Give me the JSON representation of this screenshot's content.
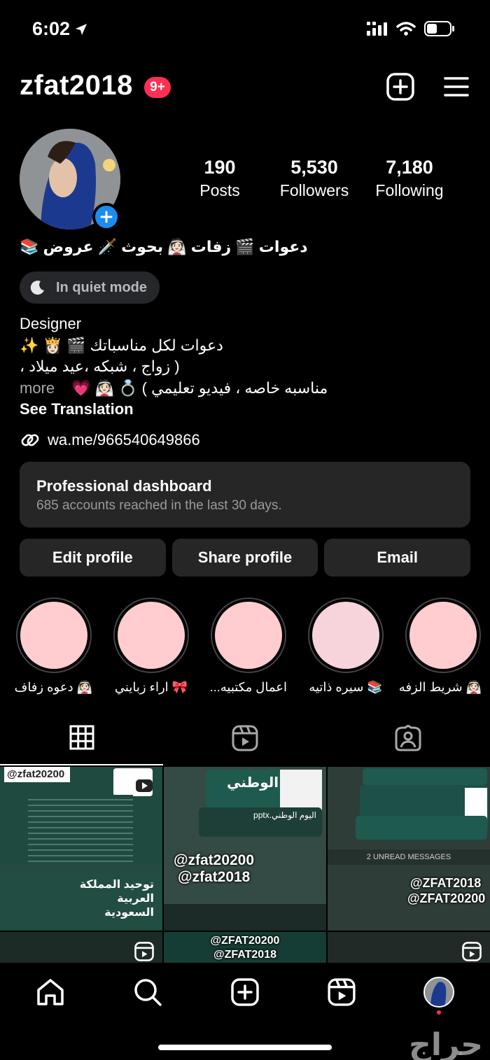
{
  "status_bar": {
    "time": "6:02"
  },
  "header": {
    "username": "zfat2018",
    "notif_badge": "9+"
  },
  "profile": {
    "stats": [
      {
        "value": "190",
        "label": "Posts"
      },
      {
        "value": "5,530",
        "label": "Followers"
      },
      {
        "value": "7,180",
        "label": "Following"
      }
    ],
    "display_name": "دعوات 🎬 زفات 👰🏻 بحوث 🗡️ عروض 📚",
    "quiet_mode": "In quiet mode",
    "bio": {
      "line1": "Designer",
      "line2": "دعوات لكل مناسباتك 🎬 👸🏻 ✨",
      "line3": "( زواج ، شبكه ،عيد ميلاد ،",
      "line4": "مناسبه خاصه ، فيديو تعليمي ) 💍 👰🏻 💗",
      "more": "more",
      "see_translation": "See Translation"
    },
    "link": "wa.me/966540649866"
  },
  "dashboard": {
    "title": "Professional dashboard",
    "subtitle": "685 accounts reached in the last 30 days."
  },
  "actions": {
    "edit": "Edit profile",
    "share": "Share profile",
    "email": "Email"
  },
  "highlights": [
    {
      "label": "👰🏻 شريط الزفه",
      "color": "#ffcdd0"
    },
    {
      "label": "📚 سيره ذاتيه",
      "color": "#f7d3dc"
    },
    {
      "label": "اعمال مكتبيه...",
      "color": "#ffcdd0"
    },
    {
      "label": "🎀 اراء زبايني",
      "color": "#ffcdd0"
    },
    {
      "label": "👰🏻 دعوه زفاف",
      "color": "#ffcdd0"
    }
  ],
  "tabs": [
    "posts-grid",
    "reels",
    "tagged"
  ],
  "grid": {
    "p1_wm": "@zfat20200",
    "p1_title": "توحيد المملكة العربية السعودية",
    "p2_title": "اليوم الوطني",
    "p2_file": "اليوم الوطني.pptx",
    "p2_wm1": "@zfat20200",
    "p2_wm2": "@zfat2018",
    "p3_wm1": "@ZFAT2018",
    "p3_wm2": "@ZFAT20200",
    "p3_unread": "2 UNREAD MESSAGES",
    "p5_wm1": "@ZFAT20200",
    "p5_wm2": "@ZFAT2018"
  },
  "watermark": "حراج"
}
